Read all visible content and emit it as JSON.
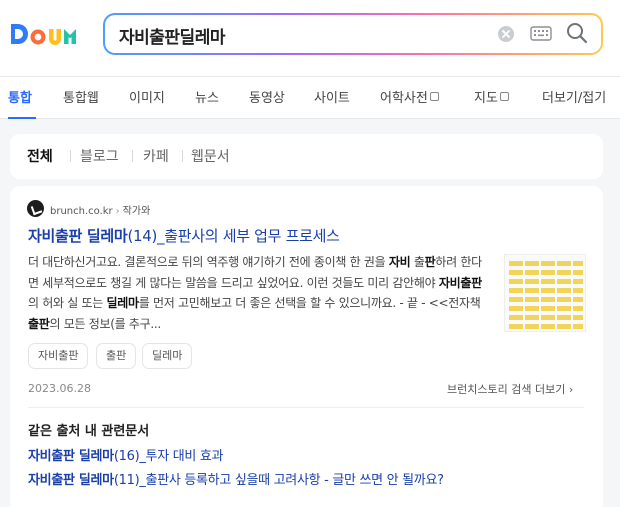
{
  "search": {
    "query": "자비출판딜레마"
  },
  "icons": {
    "logo": "daum-logo",
    "clear": "clear-icon",
    "keyboard": "keyboard-icon",
    "search": "search-icon"
  },
  "nav": {
    "tabs": [
      {
        "label": "통합",
        "active": true
      },
      {
        "label": "통합웹"
      },
      {
        "label": "이미지"
      },
      {
        "label": "뉴스"
      },
      {
        "label": "동영상"
      },
      {
        "label": "사이트"
      },
      {
        "label": "어학사전",
        "external": true
      },
      {
        "label": "지도",
        "external": true
      },
      {
        "label": "더보기/접기"
      }
    ]
  },
  "filters": {
    "tabs": [
      "전체",
      "블로그",
      "카페",
      "웹문서"
    ]
  },
  "result": {
    "source_domain": "brunch.co.kr",
    "source_author": "작가와",
    "title_strong": "자비출판 딜레마",
    "title_rest": "(14)_출판사의 세부 업무 프로세스",
    "snippet": [
      {
        "text": "더 대단하신거고요. 결론적으로 뒤의 역주행 얘기하기 전에 종이책 한 권을 "
      },
      {
        "text": "자비",
        "bold": true
      },
      {
        "text": " 출"
      },
      {
        "text": "판",
        "bold": true
      },
      {
        "text": "하려 한다면 세부적으로도 챙길 게 많다는 말씀을 드리고 싶었어요. 이런 것들도 미리 감안해야 "
      },
      {
        "text": "자비출판",
        "bold": true
      },
      {
        "text": "의 허와 실 또는 "
      },
      {
        "text": "딜레마",
        "bold": true
      },
      {
        "text": "를 먼저 고민해보고 더 좋은 선택을 할 수 있으니까요. - 끝 - <<전자책 "
      },
      {
        "text": "출판",
        "bold": true
      },
      {
        "text": "의 모든 정보(를 추구..."
      }
    ],
    "tags": [
      "자비출판",
      "출판",
      "딜레마"
    ],
    "date": "2023.06.28",
    "more_label": "브런치스토리 검색 더보기"
  },
  "related": {
    "heading": "같은 출처 내 관련문서",
    "items": [
      {
        "strong": "자비출판 딜레마",
        "rest": "(16)_투자 대비 효과"
      },
      {
        "strong": "자비출판 딜레마",
        "rest": "(11)_출판사 등록하고 싶을때 고려사항 - 글만 쓰면 안 될까요?"
      }
    ]
  },
  "colors": {
    "accent": "#2a6cff",
    "link": "#1a3faa"
  }
}
